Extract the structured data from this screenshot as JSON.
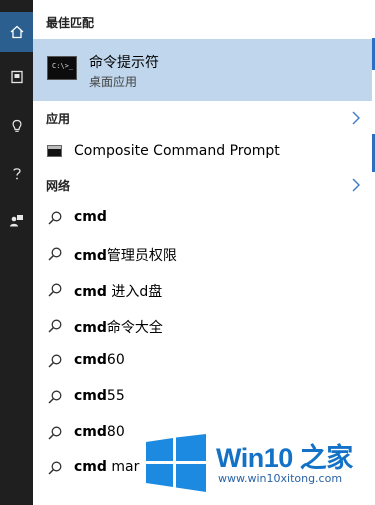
{
  "rail": {
    "icons": [
      "home-icon",
      "document-icon",
      "lightbulb-icon",
      "help-icon",
      "feedback-icon"
    ]
  },
  "sections": {
    "best_match": "最佳匹配",
    "apps": "应用",
    "web": "网络"
  },
  "best_match": {
    "icon_text": "C:\\>_",
    "title": "命令提示符",
    "subtitle": "桌面应用"
  },
  "apps": [
    {
      "label": "Composite Command Prompt"
    }
  ],
  "web_results": [
    {
      "bold": "cmd",
      "rest": ""
    },
    {
      "bold": "cmd",
      "rest": "管理员权限"
    },
    {
      "bold": "cmd",
      "rest": " 进入d盘"
    },
    {
      "bold": "cmd",
      "rest": "命令大全"
    },
    {
      "bold": "cmd",
      "rest": "60"
    },
    {
      "bold": "cmd",
      "rest": "55"
    },
    {
      "bold": "cmd",
      "rest": "80"
    },
    {
      "bold": "cmd",
      "rest": " mar"
    }
  ],
  "watermark": {
    "brand": "Win10 之家",
    "url": "www.win10xitong.com"
  },
  "colors": {
    "rail_bg": "#1f1f1f",
    "rail_active": "#2b5f90",
    "selection": "#bfd6ec",
    "accent": "#2e6ec1",
    "brand_blue": "#1372c6"
  }
}
